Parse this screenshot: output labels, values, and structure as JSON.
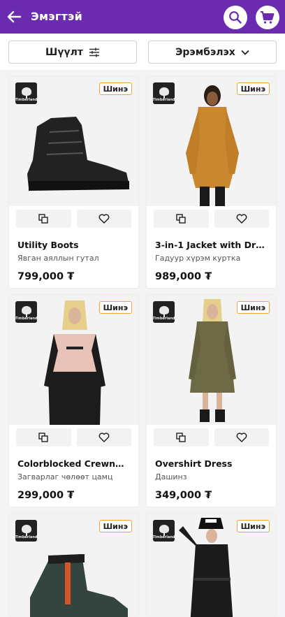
{
  "header": {
    "title": "Эмэгтэй"
  },
  "filters": {
    "filter_label": "Шүүлт",
    "sort_label": "Эрэмбэлэх"
  },
  "colors": {
    "header": "#6a2bb0",
    "badge_border": "#f2a33a"
  },
  "products": [
    {
      "brand": "Timberland",
      "badge": "Шинэ",
      "name": "Utility Boots",
      "category": "Явган аяллын гутал",
      "price": "799,000 ₮"
    },
    {
      "brand": "Timberland",
      "badge": "Шинэ",
      "name": "3-in-1 Jacket with DryV...",
      "category": "Гадуур хүрэм куртка",
      "price": "989,000 ₮"
    },
    {
      "brand": "Timberland",
      "badge": "Шинэ",
      "name": "Colorblocked Crewneck ...",
      "category": "Загварлаг чөлөөт цамц",
      "price": "299,000 ₮"
    },
    {
      "brand": "Timberland",
      "badge": "Шинэ",
      "name": "Overshirt Dress",
      "category": "Дашинз",
      "price": "349,000 ₮"
    },
    {
      "brand": "Timberland",
      "badge": "Шинэ"
    },
    {
      "brand": "Timberland",
      "badge": "Шинэ"
    }
  ]
}
